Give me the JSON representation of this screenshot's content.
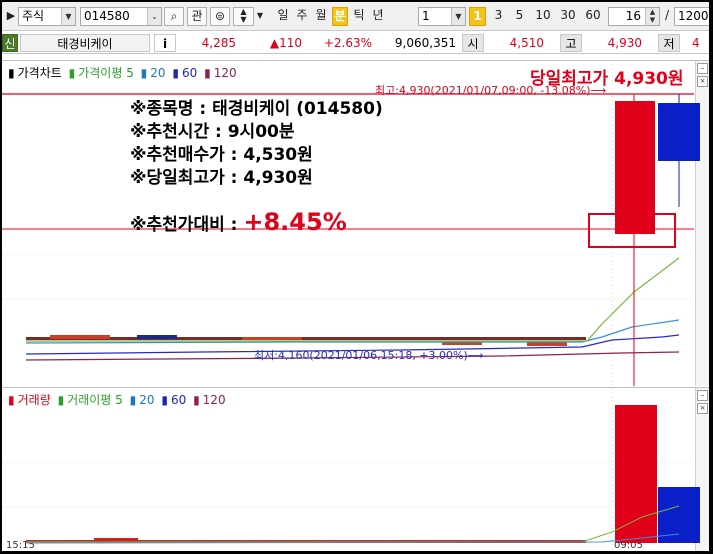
{
  "toolbar": {
    "market": "주식",
    "code": "014580",
    "btn_gwan": "관",
    "periods": [
      "일",
      "주",
      "월",
      "분",
      "틱",
      "년"
    ],
    "period_active": "분",
    "interval_value": "1",
    "quick_intervals": [
      "1",
      "3",
      "5",
      "10",
      "30",
      "60"
    ],
    "quick_active": "1",
    "count_value": "16",
    "slash": "/",
    "total_value": "1200"
  },
  "quote": {
    "badge": "신",
    "name": "태경비케이",
    "info_btn": "i",
    "price": "4,285",
    "change": "▲110",
    "change_rate": "+2.63%",
    "volume": "9,060,351",
    "open_label": "시",
    "open": "4,510",
    "high_label": "고",
    "high": "4,930",
    "low_label": "저",
    "low_partial": "4"
  },
  "price_panel": {
    "legend": [
      {
        "label": "가격차트",
        "color": "#000000"
      },
      {
        "label": "가격이평 5",
        "color": "#2ca02c"
      },
      {
        "label": "20",
        "color": "#1f77b4"
      },
      {
        "label": "60",
        "color": "#1f2ab4"
      },
      {
        "label": "120",
        "color": "#8b2252"
      }
    ],
    "day_high_banner": "당일최고가 4,930원",
    "high_marker": "최고:4,930(2021/01/07,09:00, -13.08%)⟶",
    "low_marker": "최저:4,160(2021/01/06,15:18, +3.00%)⟶",
    "annotation": [
      "※종목명 : 태경비케이 (014580)",
      "※추천시간 : 9시00분",
      "※추천매수가 : 4,530원",
      "※당일최고가 : 4,930원"
    ],
    "ratio_label": "※추천가대비 : ",
    "ratio_value": "+8.45%"
  },
  "volume_panel": {
    "legend": [
      {
        "label": "거래량",
        "color": "#e0001a"
      },
      {
        "label": "거래이평 5",
        "color": "#2ca02c"
      },
      {
        "label": "20",
        "color": "#1f77b4"
      },
      {
        "label": "60",
        "color": "#1f2ab4"
      },
      {
        "label": "120",
        "color": "#8b2252"
      }
    ],
    "axis_left": "15:15",
    "axis_right": "09:05"
  },
  "colors": {
    "up": "#e0001a",
    "down": "#0a1fc8",
    "ma5": "#79b83a",
    "ma20": "#3c8fd6",
    "ma60": "#2a2ac0",
    "ma120": "#8b2252",
    "highlight": "#f4c21d"
  }
}
